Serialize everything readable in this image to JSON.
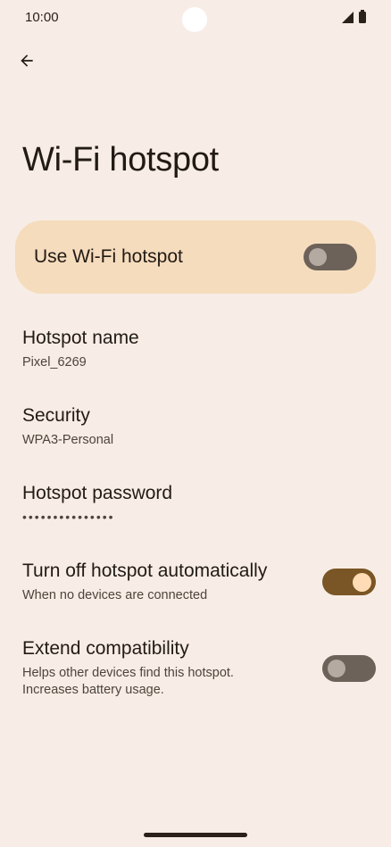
{
  "status_bar": {
    "time": "10:00",
    "icons": [
      "signal-icon",
      "battery-icon"
    ]
  },
  "header": {
    "back_icon": "arrow-left-icon",
    "title": "Wi-Fi hotspot"
  },
  "main_toggle": {
    "label": "Use Wi-Fi hotspot",
    "enabled": false
  },
  "settings": [
    {
      "title": "Hotspot name",
      "summary": "Pixel_6269"
    },
    {
      "title": "Security",
      "summary": "WPA3-Personal"
    },
    {
      "title": "Hotspot password",
      "summary": "•••••••••••••••"
    },
    {
      "title": "Turn off hotspot automatically",
      "summary": "When no devices are connected",
      "toggle": true
    },
    {
      "title": "Extend compatibility",
      "summary": "Helps other devices find this hotspot. Increases battery usage.",
      "toggle": false
    }
  ],
  "colors": {
    "background": "#f7ede6",
    "card": "#f5dcbd",
    "accent": "#7a5525"
  }
}
